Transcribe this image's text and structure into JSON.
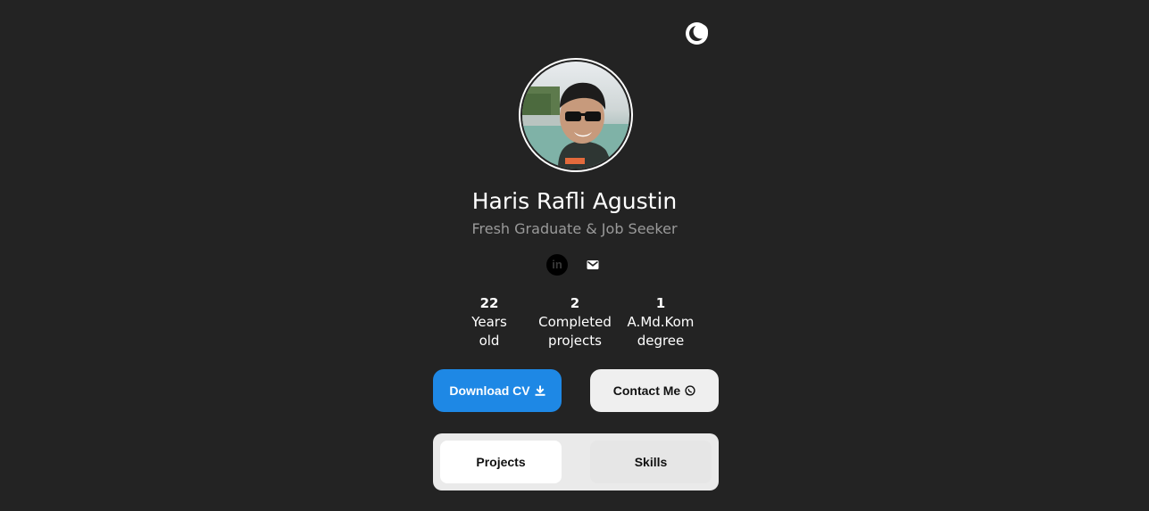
{
  "theme_toggle": {
    "icon": "moon-icon"
  },
  "profile": {
    "name": "Haris Rafli Agustin",
    "subtitle": "Fresh Graduate & Job Seeker"
  },
  "socials": {
    "linkedin_label": "in",
    "linkedin_icon": "linkedin-icon",
    "email_icon": "mail-icon"
  },
  "stats": [
    {
      "value": "22",
      "label": "Years old"
    },
    {
      "value": "2",
      "label": "Completed projects"
    },
    {
      "value": "1",
      "label": "A.Md.Kom degree"
    }
  ],
  "actions": {
    "download_label": "Download CV",
    "download_icon": "download-icon",
    "contact_label": "Contact Me",
    "contact_icon": "whatsapp-icon"
  },
  "tabs": [
    {
      "label": "Projects",
      "active": true
    },
    {
      "label": "Skills",
      "active": false
    }
  ],
  "colors": {
    "background": "#232323",
    "primary_button": "#1e88e5",
    "secondary_button": "#efefef",
    "subtitle": "#9a9a9a"
  }
}
